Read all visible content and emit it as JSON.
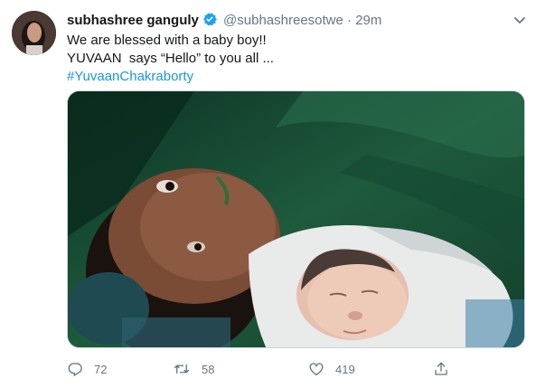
{
  "tweet": {
    "author_name": "subhashree ganguly",
    "handle": "@subhashreesotwe",
    "separator": "·",
    "time": "29m",
    "lines": [
      "We are blessed with a baby boy!!",
      "YUVAAN  says “Hello” to you all ..."
    ],
    "hashtag": "#YuvaanChakraborty"
  },
  "actions": {
    "reply_count": "72",
    "retweet_count": "58",
    "like_count": "419"
  },
  "colors": {
    "verified": "#1da1f2",
    "hashtag": "#1b95e0",
    "muted": "#657786"
  },
  "icons": [
    "verified-badge-icon",
    "chevron-down-icon",
    "reply-icon",
    "retweet-icon",
    "like-icon",
    "share-icon"
  ]
}
